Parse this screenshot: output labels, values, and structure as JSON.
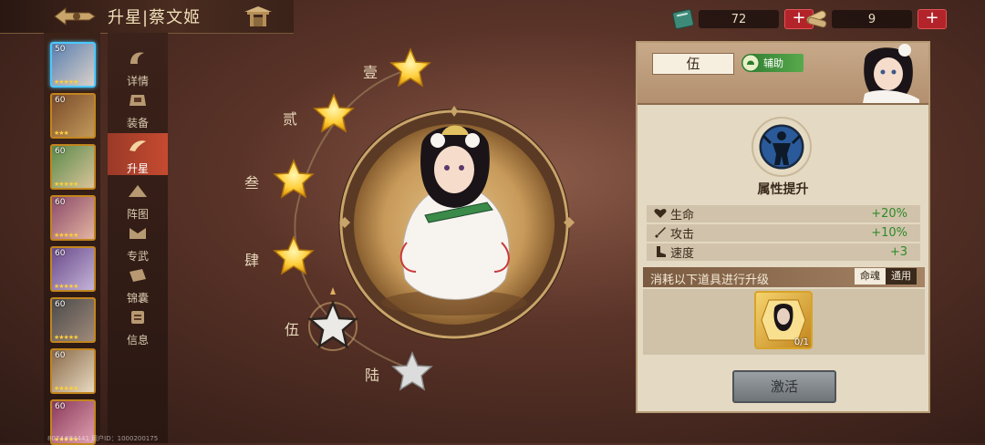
{
  "header": {
    "title": "升星|蔡文姬"
  },
  "resources": [
    {
      "icon": "scroll-book-icon",
      "value": "72"
    },
    {
      "icon": "scroll-bundle-icon",
      "value": "9"
    }
  ],
  "hero_list": [
    {
      "level": "50",
      "selected": true
    },
    {
      "level": "60",
      "selected": false
    },
    {
      "level": "60",
      "selected": false
    },
    {
      "level": "60",
      "selected": false
    },
    {
      "level": "60",
      "selected": false
    },
    {
      "level": "60",
      "selected": false
    },
    {
      "level": "60",
      "selected": false
    },
    {
      "level": "60",
      "selected": false
    }
  ],
  "side_menu": [
    {
      "label": "详情",
      "icon": "detail-icon"
    },
    {
      "label": "装备",
      "icon": "equipment-icon"
    },
    {
      "label": "升星",
      "icon": "star-up-icon",
      "active": true
    },
    {
      "label": "阵图",
      "icon": "formation-icon"
    },
    {
      "label": "专武",
      "icon": "exclusive-weapon-icon"
    },
    {
      "label": "锦囊",
      "icon": "tips-bag-icon"
    },
    {
      "label": "信息",
      "icon": "info-icon"
    }
  ],
  "star_tree": [
    {
      "label": "壹",
      "state": "filled"
    },
    {
      "label": "贰",
      "state": "filled"
    },
    {
      "label": "叁",
      "state": "filled"
    },
    {
      "label": "肆",
      "state": "filled"
    },
    {
      "label": "伍",
      "state": "current"
    },
    {
      "label": "陆",
      "state": "locked"
    }
  ],
  "panel": {
    "tier": "伍",
    "role": "辅助",
    "attr_title": "属性提升",
    "stats": [
      {
        "name": "生命",
        "value": "+20%",
        "icon": "heart-icon"
      },
      {
        "name": "攻击",
        "value": "+10%",
        "icon": "sword-icon"
      },
      {
        "name": "速度",
        "value": "+3",
        "icon": "boot-icon"
      }
    ],
    "consume_text": "消耗以下道具进行升级",
    "consume_tabs": [
      "命魂",
      "通用"
    ],
    "item_count": "0/1",
    "activate_label": "激活"
  },
  "footer": "8074#84441 用户ID：1000200175",
  "colors": {
    "accent_red": "#b3232a",
    "star_gold": "#ffcf3a",
    "stat_green": "#2f8a2a"
  }
}
